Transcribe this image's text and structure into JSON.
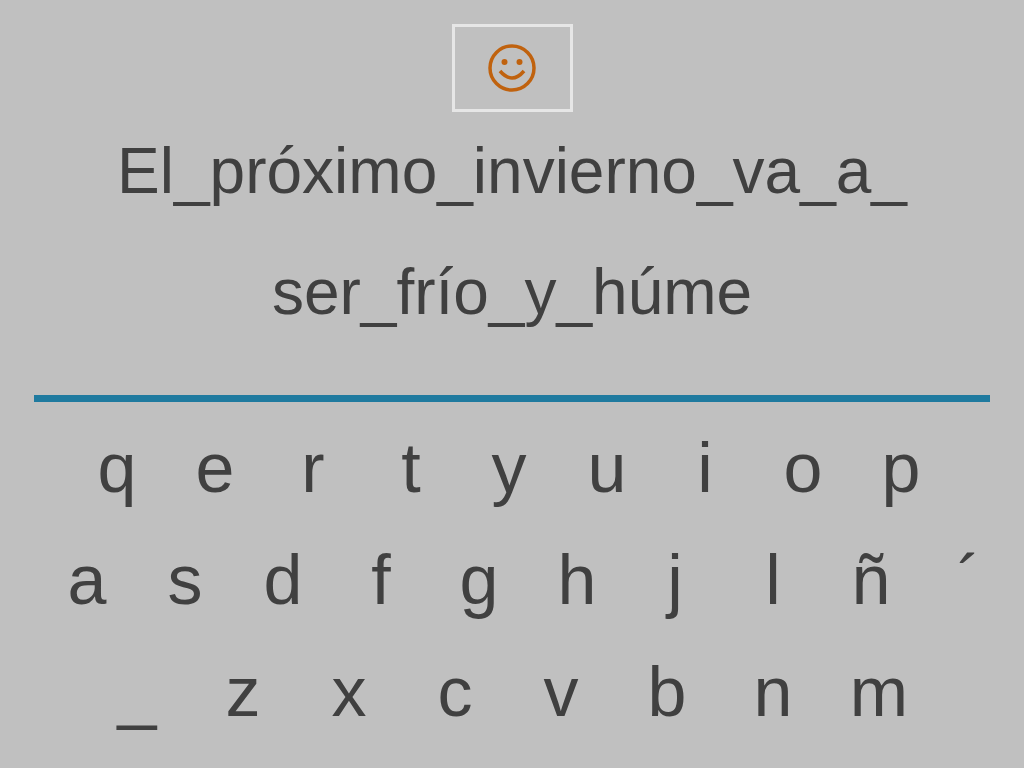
{
  "sentence_lines": [
    "El_próximo_invierno_va_a_",
    "ser_frío_y_húme"
  ],
  "keyboard_rows": [
    [
      "q",
      "e",
      "r",
      "t",
      "y",
      "u",
      "i",
      "o",
      "p"
    ],
    [
      "a",
      "s",
      "d",
      "f",
      "g",
      "h",
      "j",
      "l",
      "ñ",
      "´"
    ],
    [
      "_",
      "z",
      "x",
      "c",
      "v",
      "b",
      "n",
      "m"
    ]
  ]
}
